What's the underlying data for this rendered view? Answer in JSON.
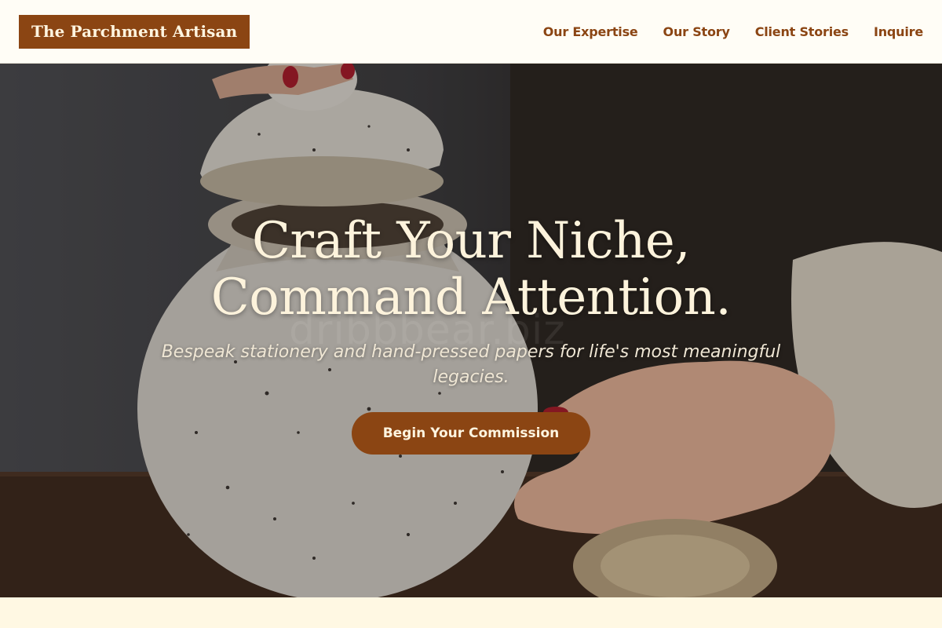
{
  "header": {
    "brand": "The Parchment Artisan",
    "nav": [
      "Our Expertise",
      "Our Story",
      "Client Stories",
      "Inquire"
    ]
  },
  "hero": {
    "headline_line1": "Craft Your Niche,",
    "headline_line2": "Command Attention.",
    "subtitle": "Bespeak stationery and hand-pressed papers for life's most meaningful legacies.",
    "cta_label": "Begin Your Commission",
    "watermark": "dribbbear.biz"
  },
  "colors": {
    "brand": "#8b4513",
    "header_bg": "#fffdf6",
    "cream_text": "#fdf3dc",
    "page_bg": "#fff8e3"
  }
}
